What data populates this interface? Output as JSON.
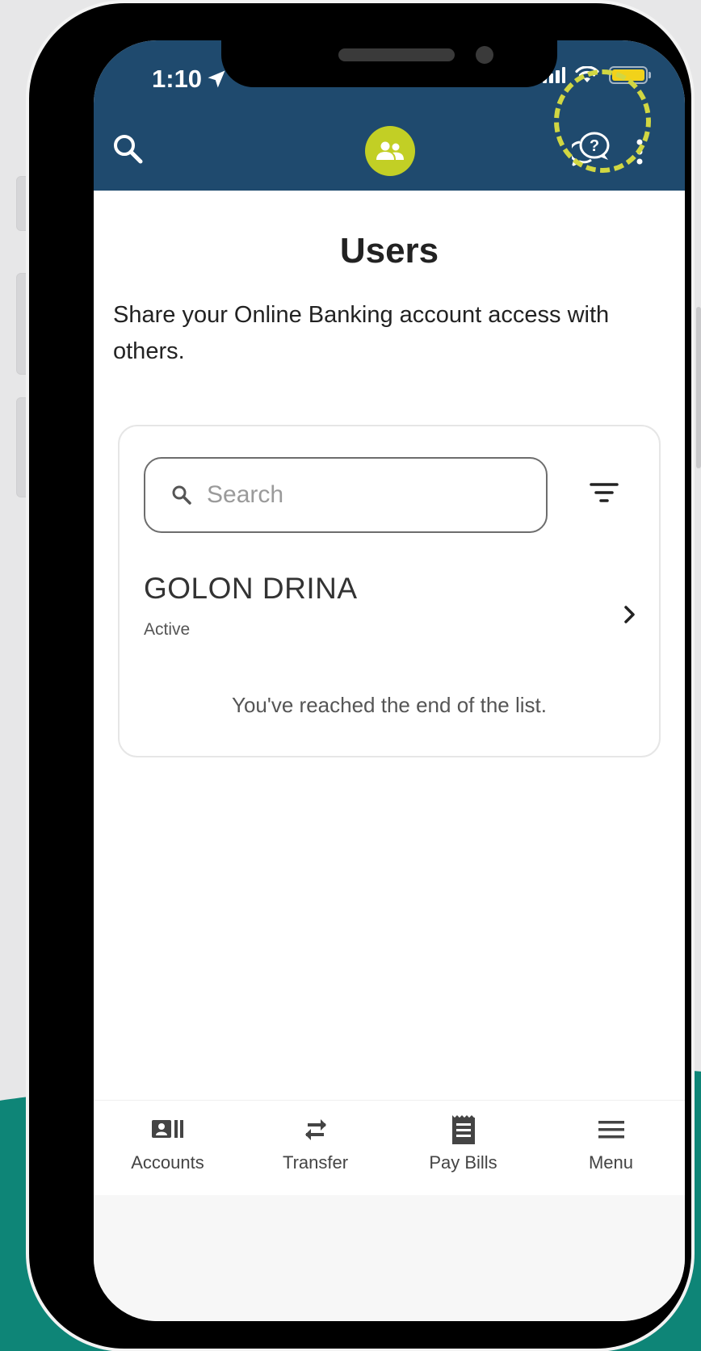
{
  "status_bar": {
    "time": "1:10"
  },
  "header": {
    "icons": [
      "search-icon",
      "users-icon",
      "help-chat-icon",
      "more-vertical-icon"
    ]
  },
  "page": {
    "title": "Users",
    "description": "Share your Online Banking account access with others."
  },
  "search": {
    "placeholder": "Search",
    "value": ""
  },
  "users": [
    {
      "name": "GOLON DRINA",
      "status": "Active"
    }
  ],
  "list_end_message": "You've reached the end of the list.",
  "tabbar": [
    {
      "label": "Accounts",
      "icon": "accounts-icon"
    },
    {
      "label": "Transfer",
      "icon": "transfer-icon"
    },
    {
      "label": "Pay Bills",
      "icon": "pay-bills-icon"
    },
    {
      "label": "Menu",
      "icon": "menu-icon"
    }
  ],
  "colors": {
    "header_bg": "#1f4a6e",
    "accent": "#c2cf25",
    "teal_bg": "#0e8577",
    "highlight": "#d1d742"
  }
}
